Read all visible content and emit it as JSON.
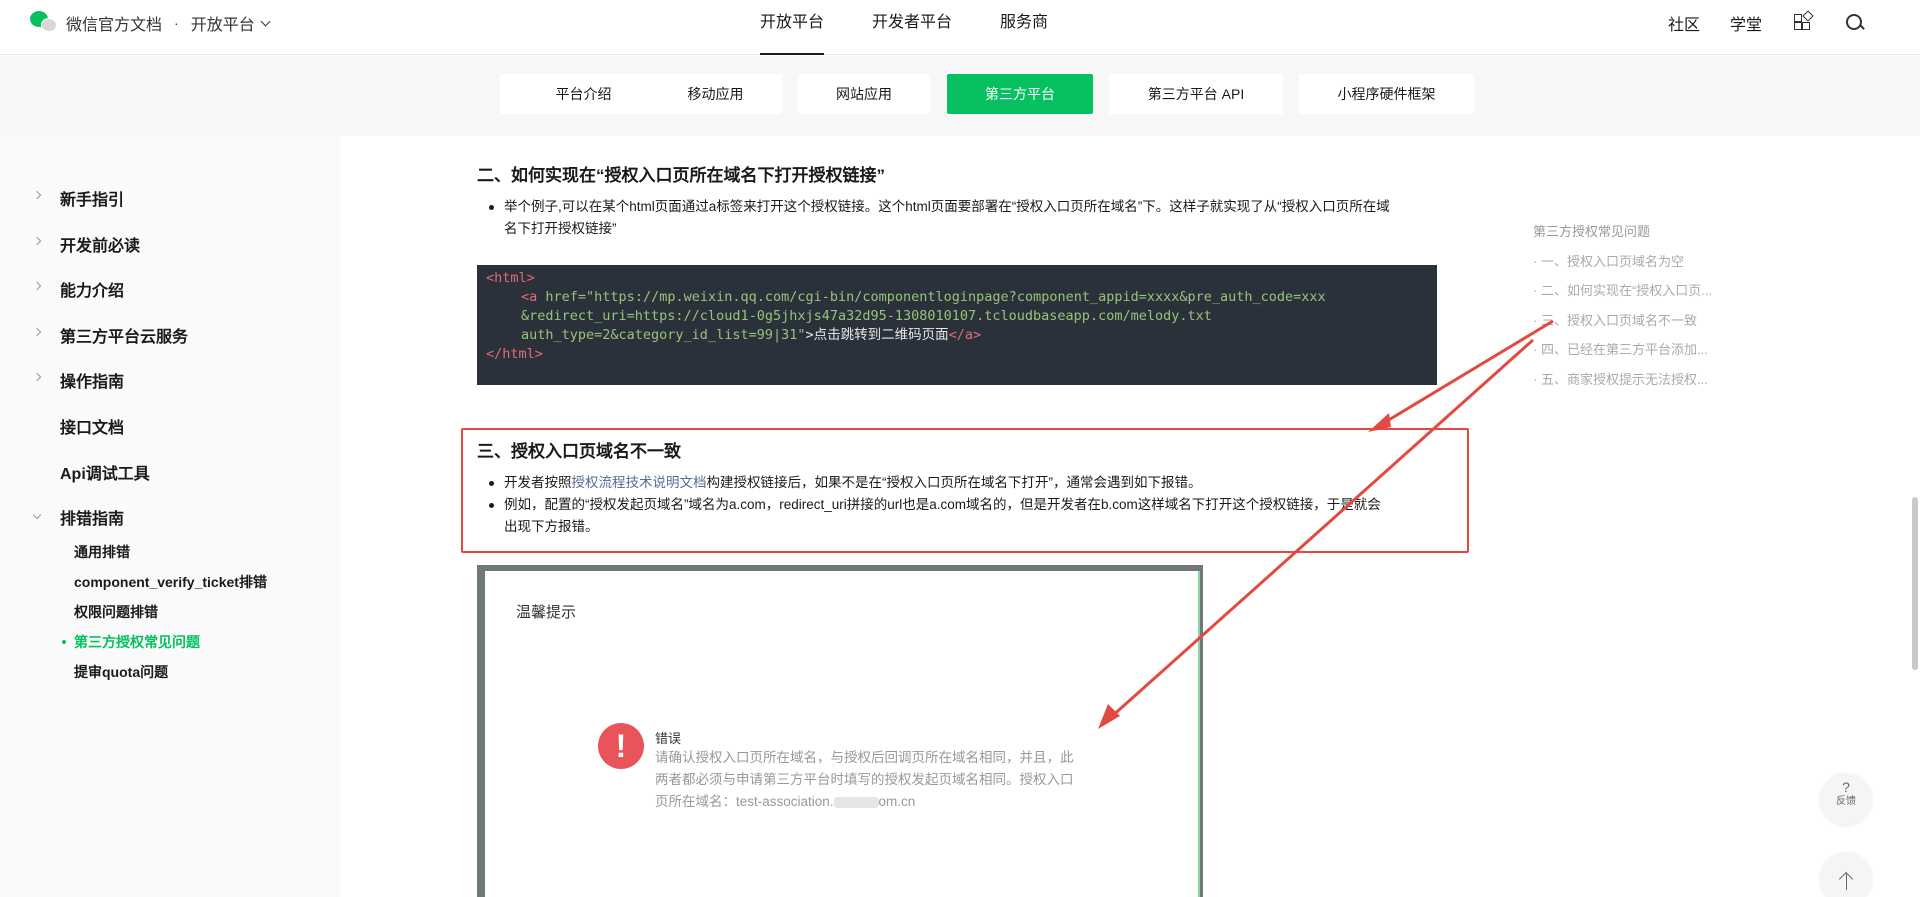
{
  "header": {
    "brand_name": "微信官方文档",
    "separator": "·",
    "section_switcher": "开放平台",
    "main_nav": [
      {
        "label": "开放平台",
        "active": true
      },
      {
        "label": "开发者平台",
        "active": false
      },
      {
        "label": "服务商",
        "active": false
      }
    ],
    "right_links": [
      "社区",
      "学堂"
    ],
    "icons": [
      "apps-icon",
      "search-icon"
    ]
  },
  "tabs": [
    {
      "label": "平台介绍",
      "active": false
    },
    {
      "label": "移动应用",
      "active": false
    },
    {
      "label": "网站应用",
      "active": false
    },
    {
      "label": "第三方平台",
      "active": true
    },
    {
      "label": "第三方平台 API",
      "active": false
    },
    {
      "label": "小程序硬件框架",
      "active": false
    }
  ],
  "sidebar": {
    "items": [
      {
        "label": "新手指引",
        "expandable": true
      },
      {
        "label": "开发前必读",
        "expandable": true
      },
      {
        "label": "能力介绍",
        "expandable": true
      },
      {
        "label": "第三方平台云服务",
        "expandable": true
      },
      {
        "label": "操作指南",
        "expandable": true
      },
      {
        "label": "接口文档",
        "expandable": false
      },
      {
        "label": "Api调试工具",
        "expandable": false
      },
      {
        "label": "排错指南",
        "expandable": true,
        "expanded": true
      }
    ],
    "subitems": [
      {
        "label": "通用排错",
        "active": false
      },
      {
        "label": "component_verify_ticket排错",
        "active": false
      },
      {
        "label": "权限问题排错",
        "active": false
      },
      {
        "label": "第三方授权常见问题",
        "active": true
      },
      {
        "label": "提审quota问题",
        "active": false
      }
    ]
  },
  "content": {
    "section2": {
      "heading": "二、如何实现在“授权入口页所在域名下打开授权链接”",
      "bullet1_line1": "举个例子,可以在某个html页面通过a标签来打开这个授权链接。这个html页面要部署在“授权入口页所在域名”下。这样子就实现了从“授权入口页所在域",
      "bullet1_line2": "名下打开授权链接”"
    },
    "code": {
      "open_tag": "<html>",
      "a_open": "<a",
      "attr_name": "href=",
      "url_line1": "\"https://mp.weixin.qq.com/cgi-bin/componentloginpage?component_appid=xxxx&pre_auth_code=xxx",
      "url_line2": "&redirect_uri=https://cloud1-0g5jhxjs47a32d95-1308010107.tcloudbaseapp.com/melody.txt",
      "url_line3": "auth_type=2&category_id_list=99|31\"",
      "gt": ">",
      "link_text": "点击跳转到二维码页面",
      "a_close": "</a>",
      "close_tag": "</html>"
    },
    "section3": {
      "heading": "三、授权入口页域名不一致",
      "bullet1_prefix": "开发者按照",
      "bullet1_link": "授权流程技术说明文档",
      "bullet1_suffix": "构建授权链接后，如果不是在“授权入口页所在域名下打开”，通常会遇到如下报错。",
      "bullet2_line1": "例如，配置的“授权发起页域名”域名为a.com，redirect_uri拼接的url也是a.com域名的，但是开发者在b.com这样域名下打开这个授权链接，于是就会",
      "bullet2_line2": "出现下方报错。"
    },
    "screenshot": {
      "title": "温馨提示",
      "error_icon": "!",
      "error_title": "错误",
      "error_line1": "请确认授权入口页所在域名，与授权后回调页所在域名相同，并且，此",
      "error_line2": "两者都必须与申请第三方平台时填写的授权发起页域名相同。授权入口",
      "error_line3": "页所在域名：test-association.",
      "error_line3_end": "om.cn"
    }
  },
  "toc": {
    "title": "第三方授权常见问题",
    "items": [
      "· 一、授权入口页域名为空",
      "· 二、如何实现在“授权入口页...",
      "· 三、授权入口页域名不一致",
      "· 四、已经在第三方平台添加...",
      "· 五、商家授权提示无法授权..."
    ]
  },
  "floating": {
    "feedback_icon": "?",
    "feedback_label": "反馈"
  },
  "colors": {
    "accent": "#07c160",
    "annotation_red": "#e34a3f",
    "code_bg": "#2b313a"
  }
}
